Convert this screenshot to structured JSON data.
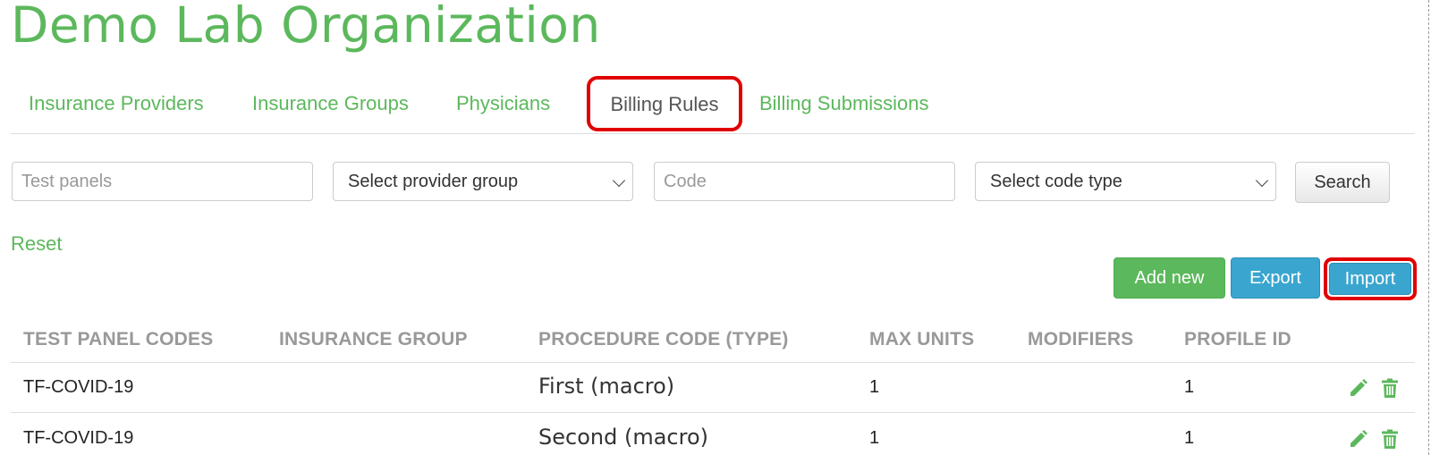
{
  "page": {
    "title": "Demo Lab Organization"
  },
  "tabs": [
    {
      "label": "Insurance Providers",
      "active": false
    },
    {
      "label": "Insurance Groups",
      "active": false
    },
    {
      "label": "Physicians",
      "active": false
    },
    {
      "label": "Billing Rules",
      "active": true
    },
    {
      "label": "Billing Submissions",
      "active": false
    }
  ],
  "filters": {
    "test_panels_placeholder": "Test panels",
    "provider_group_selected": "Select provider group",
    "code_placeholder": "Code",
    "code_type_selected": "Select code type",
    "search_label": "Search",
    "reset_label": "Reset"
  },
  "actions": {
    "add_new": "Add new",
    "export": "Export",
    "import": "Import"
  },
  "table": {
    "columns": [
      "TEST PANEL CODES",
      "INSURANCE GROUP",
      "PROCEDURE CODE (TYPE)",
      "MAX UNITS",
      "MODIFIERS",
      "PROFILE ID"
    ],
    "rows": [
      {
        "test_panel_codes": "TF-COVID-19",
        "insurance_group": "",
        "procedure_code": "First (macro)",
        "max_units": "1",
        "modifiers": "",
        "profile_id": "1"
      },
      {
        "test_panel_codes": "TF-COVID-19",
        "insurance_group": "",
        "procedure_code": "Second (macro)",
        "max_units": "1",
        "modifiers": "",
        "profile_id": "1"
      }
    ]
  },
  "icons": {
    "edit": "pencil-icon",
    "delete": "trash-icon"
  },
  "colors": {
    "brand_green": "#5cb85c",
    "info_blue": "#3aa6cf",
    "highlight_red": "#e00000",
    "header_gray": "#999999"
  }
}
